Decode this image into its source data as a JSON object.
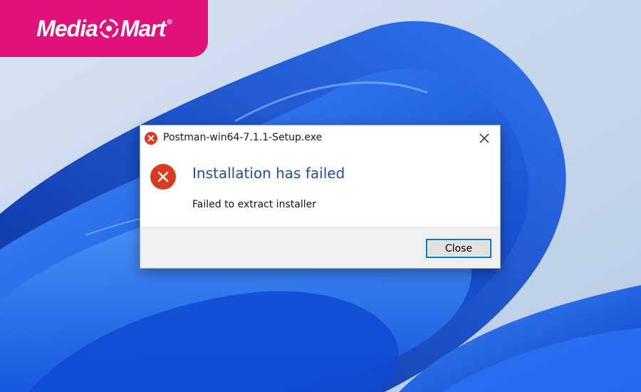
{
  "brand": {
    "name_left": "Media",
    "name_right": "Mart",
    "reg": "®"
  },
  "dialog": {
    "title": "Postman-win64-7.1.1-Setup.exe",
    "heading": "Installation has failed",
    "message": "Failed to extract installer",
    "close_button": "Close",
    "icons": {
      "title": "error-icon",
      "main": "error-icon",
      "close": "close-icon"
    }
  },
  "colors": {
    "brand_pink": "#e0117a",
    "error_red": "#d83b22",
    "heading_blue": "#1e4fa6",
    "focus_blue": "#0078d7",
    "wallpaper_blue": "#1a5fe0"
  }
}
